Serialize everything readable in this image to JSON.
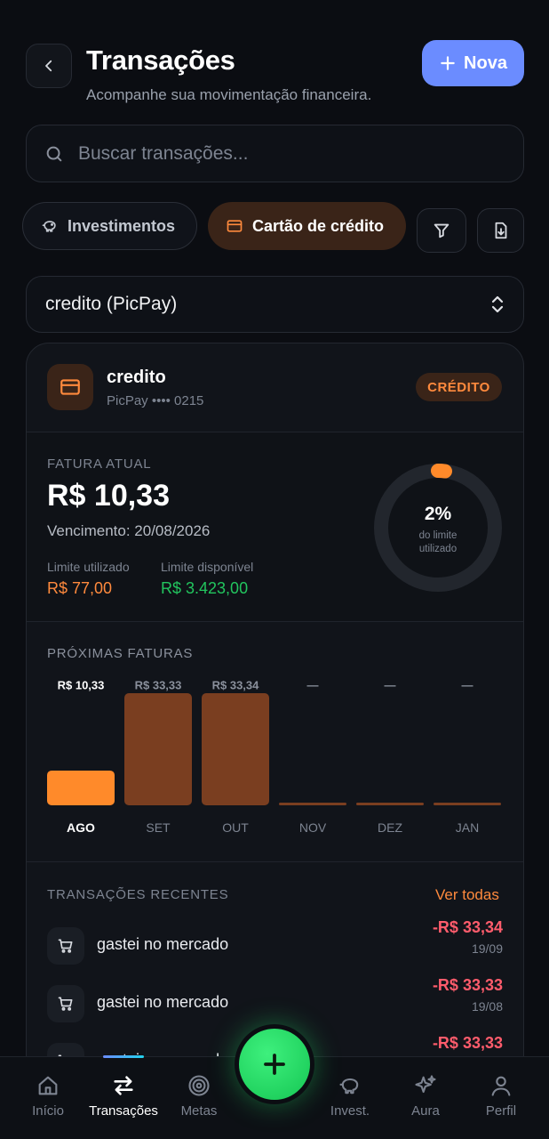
{
  "header": {
    "title": "Transações",
    "subtitle": "Acompanhe sua movimentação financeira.",
    "new_label": "Nova"
  },
  "search": {
    "placeholder": "Buscar transações..."
  },
  "filters": {
    "investments_label": "Investimentos",
    "credit_card_label": "Cartão de crédito"
  },
  "account_select": {
    "value": "credito (PicPay)"
  },
  "card": {
    "name": "credito",
    "details": "PicPay •••• 0215",
    "badge": "CRÉDITO",
    "invoice_label": "FATURA ATUAL",
    "invoice_amount": "R$ 10,33",
    "due_date": "Vencimento: 20/08/2026",
    "limit_used_label": "Limite utilizado",
    "limit_used_value": "R$ 77,00",
    "limit_available_label": "Limite disponível",
    "limit_available_value": "R$ 3.423,00",
    "usage_percent_label": "2%",
    "usage_fraction": 0.02,
    "usage_caption_line1": "do limite",
    "usage_caption_line2": "utilizado"
  },
  "upcoming": {
    "title": "PRÓXIMAS FATURAS",
    "active_color": "#ff8a2a",
    "inactive_color": "#7a3e20"
  },
  "chart_data": {
    "type": "bar",
    "categories": [
      "AGO",
      "SET",
      "OUT",
      "NOV",
      "DEZ",
      "JAN"
    ],
    "values": [
      10.33,
      33.33,
      33.34,
      0,
      0,
      0
    ],
    "value_labels": [
      "R$ 10,33",
      "R$ 33,33",
      "R$ 33,34",
      "—",
      "—",
      "—"
    ],
    "active_index": 0
  },
  "recent": {
    "title": "TRANSAÇÕES RECENTES",
    "see_all": "Ver todas",
    "items": [
      {
        "description": "gastei no mercado",
        "amount": "-R$ 33,34",
        "date": "19/09",
        "icon": "cart-icon"
      },
      {
        "description": "gastei no mercado",
        "amount": "-R$ 33,33",
        "date": "19/08",
        "icon": "cart-icon"
      },
      {
        "description": "gastei no mercado",
        "amount": "-R$ 33,33",
        "date": "",
        "icon": "cart-icon"
      }
    ]
  },
  "nav": {
    "home": "Início",
    "transactions": "Transações",
    "goals": "Metas",
    "invest": "Invest.",
    "aura": "Aura",
    "profile": "Perfil"
  }
}
